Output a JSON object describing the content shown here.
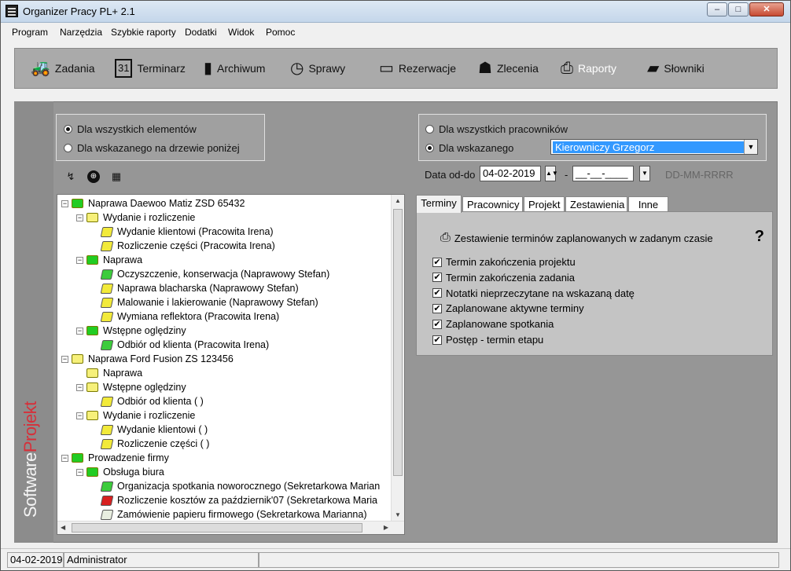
{
  "app": {
    "title": "Organizer Pracy PL+ 2.1"
  },
  "window_controls": {
    "minimize": "–",
    "maximize": "□",
    "close": "✕"
  },
  "menu": [
    "Program",
    "Narzędzia",
    "Szybkie raporty",
    "Dodatki",
    "Widok",
    "Pomoc"
  ],
  "toolbar": [
    {
      "label": "Zadania",
      "icon": "tasks-icon",
      "glyph": "🚜"
    },
    {
      "label": "Terminarz",
      "icon": "calendar-icon",
      "glyph": "31"
    },
    {
      "label": "Archiwum",
      "icon": "binder-icon",
      "glyph": "▮"
    },
    {
      "label": "Sprawy",
      "icon": "clock-icon",
      "glyph": "◷"
    },
    {
      "label": "Rezerwacje",
      "icon": "computer-icon",
      "glyph": "▭"
    },
    {
      "label": "Zlecenia",
      "icon": "people-icon",
      "glyph": "☗"
    },
    {
      "label": "Raporty",
      "icon": "printer-icon",
      "glyph": "⎙",
      "active": true
    },
    {
      "label": "Słowniki",
      "icon": "book-icon",
      "glyph": "▰"
    }
  ],
  "brand": {
    "part1": "Software",
    "part2": "Projekt"
  },
  "scope": {
    "options": [
      "Dla wszystkich elementów",
      "Dla wskazanego na drzewie poniżej"
    ],
    "selected": 0
  },
  "tree_actions": [
    {
      "name": "refresh-icon",
      "glyph": "↯"
    },
    {
      "name": "search-icon",
      "glyph": "⊕"
    },
    {
      "name": "calendar-settings-icon",
      "glyph": "▦"
    }
  ],
  "tree": [
    {
      "level": 0,
      "label": "Naprawa Daewoo Matiz ZSD 65432",
      "kind": "folder",
      "color": "#22cc22",
      "expand": "−"
    },
    {
      "level": 1,
      "label": "Wydanie i rozliczenie",
      "kind": "folder",
      "color": "#f6f07a",
      "expand": "−"
    },
    {
      "level": 2,
      "label": "Wydanie klientowi (Pracowita Irena)",
      "kind": "leaf",
      "color": "#f2ea3a"
    },
    {
      "level": 2,
      "label": "Rozliczenie części (Pracowita Irena)",
      "kind": "leaf",
      "color": "#f2ea3a"
    },
    {
      "level": 1,
      "label": "Naprawa",
      "kind": "folder",
      "color": "#22cc22",
      "expand": "−"
    },
    {
      "level": 2,
      "label": "Oczyszczenie, konserwacja (Naprawowy Stefan)",
      "kind": "leaf",
      "color": "#3ccc3c"
    },
    {
      "level": 2,
      "label": "Naprawa blacharska (Naprawowy Stefan)",
      "kind": "leaf",
      "color": "#f2ea3a"
    },
    {
      "level": 2,
      "label": "Malowanie i lakierowanie (Naprawowy Stefan)",
      "kind": "leaf",
      "color": "#f2ea3a"
    },
    {
      "level": 2,
      "label": "Wymiana reflektora (Pracowita Irena)",
      "kind": "leaf",
      "color": "#f2ea3a"
    },
    {
      "level": 1,
      "label": "Wstępne oględziny",
      "kind": "folder",
      "color": "#22cc22",
      "expand": "−"
    },
    {
      "level": 2,
      "label": "Odbiór od klienta (Pracowita Irena)",
      "kind": "leaf",
      "color": "#3ccc3c"
    },
    {
      "level": 0,
      "label": "Naprawa Ford Fusion ZS 123456",
      "kind": "folder",
      "color": "#f6f07a",
      "expand": "−"
    },
    {
      "level": 1,
      "label": "Naprawa",
      "kind": "folder",
      "color": "#f6f07a",
      "expand": ""
    },
    {
      "level": 1,
      "label": "Wstępne oględziny",
      "kind": "folder",
      "color": "#f6f07a",
      "expand": "−"
    },
    {
      "level": 2,
      "label": "Odbiór od klienta ( )",
      "kind": "leaf",
      "color": "#f2ea3a"
    },
    {
      "level": 1,
      "label": "Wydanie i rozliczenie",
      "kind": "folder",
      "color": "#f6f07a",
      "expand": "−"
    },
    {
      "level": 2,
      "label": "Wydanie klientowi ( )",
      "kind": "leaf",
      "color": "#f2ea3a"
    },
    {
      "level": 2,
      "label": "Rozliczenie części ( )",
      "kind": "leaf",
      "color": "#f2ea3a"
    },
    {
      "level": 0,
      "label": "Prowadzenie firmy",
      "kind": "folder",
      "color": "#22cc22",
      "expand": "−"
    },
    {
      "level": 1,
      "label": "Obsługa biura",
      "kind": "folder",
      "color": "#22cc22",
      "expand": "−"
    },
    {
      "level": 2,
      "label": "Organizacja spotkania noworocznego (Sekretarkowa Marian",
      "kind": "leaf",
      "color": "#3ccc3c"
    },
    {
      "level": 2,
      "label": "Rozliczenie kosztów za październik'07 (Sekretarkowa Maria",
      "kind": "leaf",
      "color": "#d82020"
    },
    {
      "level": 2,
      "label": "Zamówienie papieru firmowego (Sekretarkowa Marianna)",
      "kind": "leaf",
      "color": "#e8eee0"
    }
  ],
  "employees": {
    "options": [
      "Dla wszystkich pracowników",
      "Dla wskazanego"
    ],
    "selected": 1,
    "selected_employee": "Kierowniczy Grzegorz"
  },
  "date_range": {
    "label": "Data od-do",
    "from": "04-02-2019",
    "to": "__-__-____",
    "separator": "-",
    "format_hint": "DD-MM-RRRR"
  },
  "tabs": [
    "Terminy",
    "Pracownicy",
    "Projekt",
    "Zestawienia",
    "Inne"
  ],
  "active_tab": "Terminy",
  "report": {
    "title": "Zestawienie terminów zaplanowanych w zadanym czasie",
    "help": "?",
    "options": [
      {
        "label": "Termin zakończenia projektu",
        "checked": true
      },
      {
        "label": "Termin zakończenia zadania",
        "checked": true
      },
      {
        "label": "Notatki nieprzeczytane na wskazaną datę",
        "checked": true
      },
      {
        "label": "Zaplanowane aktywne terminy",
        "checked": true
      },
      {
        "label": "Zaplanowane spotkania",
        "checked": true
      },
      {
        "label": "Postęp - termin etapu",
        "checked": true
      }
    ]
  },
  "status": {
    "date": "04-02-2019",
    "user": "Administrator"
  }
}
